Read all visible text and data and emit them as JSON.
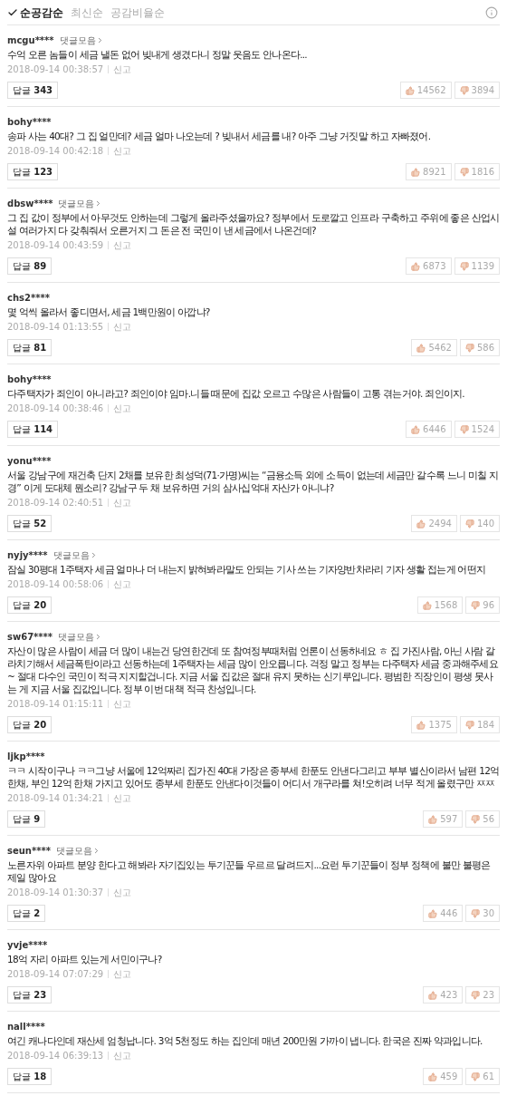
{
  "sort_tabs": [
    {
      "label": "순공감순",
      "selected": true
    },
    {
      "label": "최신순",
      "selected": false
    },
    {
      "label": "공감비율순",
      "selected": false
    }
  ],
  "comments": [
    {
      "user": "mcgu****",
      "collection_link": "댓글모음",
      "text": "수억 오른 놈들이 세금 낼돈 없어 빚내게 생겼다니 정말 웃음도 안나온다...",
      "time": "2018-09-14 00:38:57",
      "report": "신고",
      "reply_label": "답글",
      "reply_count": "343",
      "likes": "14562",
      "dislikes": "3894"
    },
    {
      "user": "bohy****",
      "text": "송파 사는 40대? 그 집 얼만데? 세금 얼마 나오는데 ? 빚내서 세금를 내? 아주 그냥 거짓말 하고 자빠졌어.",
      "time": "2018-09-14 00:42:18",
      "report": "신고",
      "reply_label": "답글",
      "reply_count": "123",
      "likes": "8921",
      "dislikes": "1816"
    },
    {
      "user": "dbsw****",
      "collection_link": "댓글모음",
      "text": "그 집 값이 정부에서 아무것도 안하는데 그렇게 올라주셨을까요? 정부에서 도로깔고 인프라 구축하고 주위에 좋은 산업시설 여러가지 다 갖춰줘서 오른거지 그 돈은 전 국민이 낸 세금에서 나온건데?",
      "time": "2018-09-14 00:43:59",
      "report": "신고",
      "reply_label": "답글",
      "reply_count": "89",
      "likes": "6873",
      "dislikes": "1139"
    },
    {
      "user": "chs2****",
      "text": "몇 억씩 올라서 좋디면서, 세금 1백만원이 아깝냐?",
      "time": "2018-09-14 01:13:55",
      "report": "신고",
      "reply_label": "답글",
      "reply_count": "81",
      "likes": "5462",
      "dislikes": "586"
    },
    {
      "user": "bohy****",
      "text": "다주택자가 죄인이 아니라고? 죄인이야 임마.니들 때문에 집값 오르고 수많은 사람들이 고통 겪는거야. 죄인이지.",
      "time": "2018-09-14 00:38:46",
      "report": "신고",
      "reply_label": "답글",
      "reply_count": "114",
      "likes": "6446",
      "dislikes": "1524"
    },
    {
      "user": "yonu****",
      "text": "서울 강남구에 재건축 단지 2채를 보유한 최성덕(71·가명)씨는 “금융소득 외에 소득이 없는데 세금만 갈수록 느니 미칠 지경” 이게 도대체 뭔소리? 강남구 두 채 보유하면 거의 삼사십억대 자산가 아니냐?",
      "time": "2018-09-14 02:40:51",
      "report": "신고",
      "reply_label": "답글",
      "reply_count": "52",
      "likes": "2494",
      "dislikes": "140"
    },
    {
      "user": "nyjy****",
      "collection_link": "댓글모음",
      "text": "잠실 30평대 1주택자 세금 얼마나 더 내는지 밝혀봐라말도 안되는 기사 쓰는 기자양반차라리 기자 생활 접는게 어떤지",
      "time": "2018-09-14 00:58:06",
      "report": "신고",
      "reply_label": "답글",
      "reply_count": "20",
      "likes": "1568",
      "dislikes": "96"
    },
    {
      "user": "sw67****",
      "collection_link": "댓글모음",
      "text": "자산이 많은 사람이 세금 더 많이 내는건 당연한건데 또 참여정부때처럼 언론이 선동하네요 ㅎ 집 가진사람, 아닌 사람 갈라치기해서 세금폭탄이라고 선동하는데 1주택자는 세금 많이 안오릅니다. 걱정 말고 정부는 다주택자 세금 중과해주세요~ 절대 다수인 국민이 적극 지지할겁니다. 지금 서울 집값은 절대 유지 못하는 신기루입니다. 평범한 직장인이 평생 못사는 게 지금 서울 집값입니다. 정부 이번 대책 적극 찬성입니다.",
      "time": "2018-09-14 01:15:11",
      "report": "신고",
      "reply_label": "답글",
      "reply_count": "20",
      "likes": "1375",
      "dislikes": "184"
    },
    {
      "user": "ljkp****",
      "text": "ㅋㅋ 시작이구나 ㅋㅋ그냥 서울에 12억짜리 집가진 40대 가장은 종부세 한푼도 안낸다그리고 부부 별산이라서 남편 12억 한채, 부인 12억 한채 가지고 있어도 종부세 한푼도 안낸다이것들이 어디서 개구라를 쳐!오히려 너무 적게 올렸구만 ㅉㅉ",
      "time": "2018-09-14 01:34:21",
      "report": "신고",
      "reply_label": "답글",
      "reply_count": "9",
      "likes": "597",
      "dislikes": "56"
    },
    {
      "user": "seun****",
      "collection_link": "댓글모음",
      "text": "노른자위 아파트 분양 한다고 해봐라 자기집있는 투기꾼들 우르르 달려드지...요런 투기꾼들이 정부 정책에 불만 불평은 제일 많아요",
      "time": "2018-09-14 01:30:37",
      "report": "신고",
      "reply_label": "답글",
      "reply_count": "2",
      "likes": "446",
      "dislikes": "30"
    },
    {
      "user": "yvje****",
      "text": "18억 자리 아파트 있는게 서민이구나?",
      "time": "2018-09-14 07:07:29",
      "report": "신고",
      "reply_label": "답글",
      "reply_count": "23",
      "likes": "423",
      "dislikes": "23"
    },
    {
      "user": "nall****",
      "text": "여긴 캐나다인데 재산세 엄청납니다. 3억 5천정도 하는 집인데 매년 200만원 가까이 냅니다. 한국은 진짜 약과입니다.",
      "time": "2018-09-14 06:39:13",
      "report": "신고",
      "reply_label": "답글",
      "reply_count": "18",
      "likes": "459",
      "dislikes": "61"
    }
  ]
}
